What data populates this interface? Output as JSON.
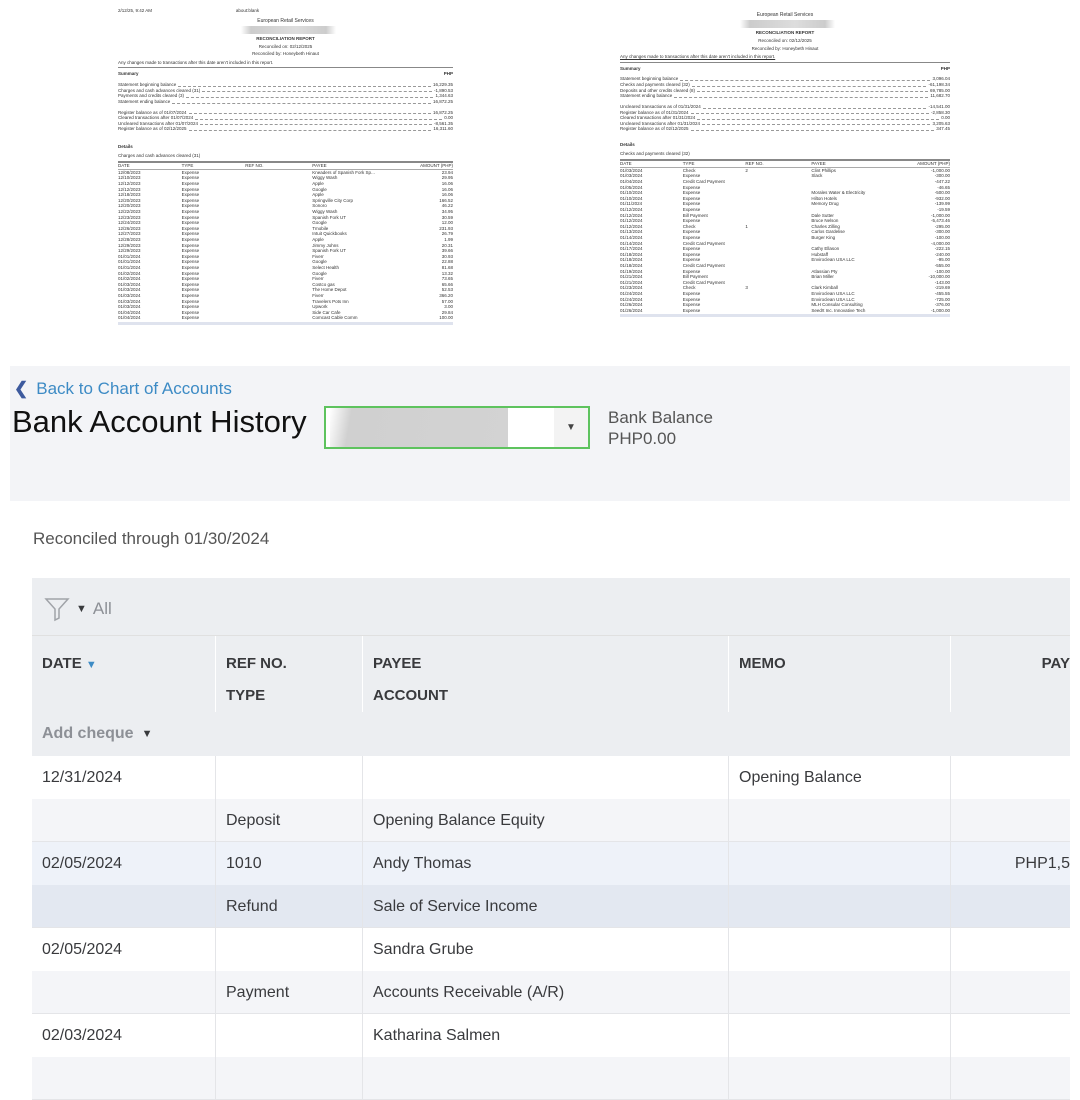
{
  "report_left": {
    "timestamp": "2/12/25, 9:42 AM",
    "page_title": "about:blank",
    "company": "European Retail Services",
    "title": "RECONCILIATION REPORT",
    "reconciled_on": "Reconciled on: 02/12/2025",
    "reconciled_by": "Reconciled by: Honeybeth Hinaut",
    "notice": "Any changes made to transactions after this date aren't included in this report.",
    "summary_label": "Summary",
    "currency": "PHP",
    "summary": [
      {
        "label": "Statement beginning balance",
        "value": "16,229.35"
      },
      {
        "label": "Charges and cash advances cleared (31)",
        "value": "-1,890.53"
      },
      {
        "label": "Payments and credits cleared (3)",
        "value": "1,344.63"
      },
      {
        "label": "Statement ending balance",
        "value": "16,872.25"
      }
    ],
    "summary2": [
      {
        "label": "Register balance as of 01/07/2024",
        "value": "16,872.25"
      },
      {
        "label": "Cleared transactions after 01/07/2024",
        "value": "0.00"
      },
      {
        "label": "Uncleared transactions after 01/07/2024",
        "value": "-8,561.35"
      },
      {
        "label": "Register balance as of 02/12/2025",
        "value": "16,311.60"
      }
    ],
    "details_label": "Details",
    "section_label": "Charges and cash advances cleared (31)",
    "columns": [
      "DATE",
      "TYPE",
      "REF NO.",
      "PAYEE",
      "AMOUNT (PHP)"
    ],
    "rows": [
      [
        "12/08/2023",
        "Expense",
        "",
        "Kneaders of Spanish Fork Sp...",
        "23.94"
      ],
      [
        "12/10/2023",
        "Expense",
        "",
        "Wiggy Wash",
        "29.95"
      ],
      [
        "12/12/2023",
        "Expense",
        "",
        "Apple",
        "16.06"
      ],
      [
        "12/12/2023",
        "Expense",
        "",
        "Google",
        "16.06"
      ],
      [
        "12/18/2023",
        "Expense",
        "",
        "Apple",
        "16.06"
      ],
      [
        "12/20/2023",
        "Expense",
        "",
        "Springville City Corp",
        "166.52"
      ],
      [
        "12/20/2023",
        "Expense",
        "",
        "Sonoro",
        "46.22"
      ],
      [
        "12/22/2023",
        "Expense",
        "",
        "Wiggy Wash",
        "34.95"
      ],
      [
        "12/23/2023",
        "Expense",
        "",
        "Spanish Fork UT",
        "30.59"
      ],
      [
        "12/24/2023",
        "Expense",
        "",
        "Google",
        "12.00"
      ],
      [
        "12/26/2023",
        "Expense",
        "",
        "Tmobile",
        "231.93"
      ],
      [
        "12/27/2023",
        "Expense",
        "",
        "Intuit Quickbooks",
        "26.79"
      ],
      [
        "12/28/2023",
        "Expense",
        "",
        "Apple",
        "1.99"
      ],
      [
        "12/29/2023",
        "Expense",
        "",
        "Jimmy Johns",
        "20.31"
      ],
      [
        "12/29/2023",
        "Expense",
        "",
        "Spanish Fork UT",
        "39.66"
      ],
      [
        "01/01/2024",
        "Expense",
        "",
        "Fiverr",
        "30.93"
      ],
      [
        "01/01/2024",
        "Expense",
        "",
        "Google",
        "22.88"
      ],
      [
        "01/01/2024",
        "Expense",
        "",
        "Select Health",
        "81.68"
      ],
      [
        "01/02/2024",
        "Expense",
        "",
        "Google",
        "13.32"
      ],
      [
        "01/02/2024",
        "Expense",
        "",
        "Fiverr",
        "73.65"
      ],
      [
        "01/03/2024",
        "Expense",
        "",
        "Costco gas",
        "65.66"
      ],
      [
        "01/03/2024",
        "Expense",
        "",
        "The Home Depot",
        "52.53"
      ],
      [
        "01/03/2024",
        "Expense",
        "",
        "Fiverr",
        "366.20"
      ],
      [
        "01/03/2024",
        "Expense",
        "",
        "Travelers Pots Inn",
        "57.00"
      ],
      [
        "01/03/2024",
        "Expense",
        "",
        "Upwork",
        "3.00"
      ],
      [
        "01/04/2024",
        "Expense",
        "",
        "Side Car Cafe",
        "29.84"
      ],
      [
        "01/04/2024",
        "Expense",
        "",
        "Comcast Cable Comm",
        "100.00"
      ]
    ]
  },
  "report_right": {
    "company": "European Retail Services",
    "title": "RECONCILIATION REPORT",
    "reconciled_on": "Reconciled on: 02/12/2025",
    "reconciled_by": "Reconciled by: Honeybeth Hinaut",
    "notice": "Any changes made to transactions after this date aren't included in this report.",
    "summary_label": "Summary",
    "currency": "PHP",
    "summary": [
      {
        "label": "Statement beginning balance",
        "value": "3,096.04"
      },
      {
        "label": "Checks and payments cleared (32)",
        "value": "-61,198.34"
      },
      {
        "label": "Deposits and other credits cleared (8)",
        "value": "69,785.00"
      },
      {
        "label": "Statement ending balance",
        "value": "11,682.70"
      }
    ],
    "summary2": [
      {
        "label": "Uncleared transactions as of 01/31/2024",
        "value": "-14,541.00"
      },
      {
        "label": "Register balance as of 01/31/2024",
        "value": "-2,858.30"
      },
      {
        "label": "Cleared transactions after 01/31/2024",
        "value": "0.00"
      },
      {
        "label": "Uncleared transactions after 01/31/2024",
        "value": "3,205.63"
      },
      {
        "label": "Register balance as of 02/12/2025",
        "value": "347.45"
      }
    ],
    "details_label": "Details",
    "section_label": "Checks and payments cleared (32)",
    "columns": [
      "DATE",
      "TYPE",
      "REF NO.",
      "PAYEE",
      "AMOUNT (PHP)"
    ],
    "rows": [
      [
        "01/03/2024",
        "Check",
        "2",
        "Clint Phillips",
        "-1,000.00"
      ],
      [
        "01/03/2024",
        "Expense",
        "",
        "Slack",
        "-300.00"
      ],
      [
        "01/04/2024",
        "Credit Card Payment",
        "",
        "",
        "-447.22"
      ],
      [
        "01/05/2024",
        "Expense",
        "",
        "",
        "-46.65"
      ],
      [
        "01/10/2024",
        "Expense",
        "",
        "Morales Water & Electricity",
        "-500.00"
      ],
      [
        "01/10/2024",
        "Expense",
        "",
        "Hilton Hotels",
        "-932.00"
      ],
      [
        "01/11/2024",
        "Expense",
        "",
        "Memory Drug",
        "-139.99"
      ],
      [
        "01/12/2024",
        "Expense",
        "",
        "",
        "-19.59"
      ],
      [
        "01/12/2024",
        "Bill Payment",
        "",
        "Dale Sutter",
        "-1,000.00"
      ],
      [
        "01/12/2024",
        "Expense",
        "",
        "Bruce Nelson",
        "-5,473.46"
      ],
      [
        "01/12/2024",
        "Check",
        "1",
        "Charles Zilling",
        "-295.00"
      ],
      [
        "01/13/2024",
        "Expense",
        "",
        "Carlos Gardelise",
        "-300.00"
      ],
      [
        "01/14/2024",
        "Expense",
        "",
        "Burger King",
        "-100.00"
      ],
      [
        "01/14/2024",
        "Credit Card Payment",
        "",
        "",
        "-4,000.00"
      ],
      [
        "01/17/2024",
        "Expense",
        "",
        "Cathy Ellason",
        "-222.15"
      ],
      [
        "01/18/2024",
        "Expense",
        "",
        "Hubstaff",
        "-240.00"
      ],
      [
        "01/18/2024",
        "Expense",
        "",
        "Enviroclean USA LLC",
        "-95.00"
      ],
      [
        "01/18/2024",
        "Credit Card Payment",
        "",
        "",
        "-555.00"
      ],
      [
        "01/19/2024",
        "Expense",
        "",
        "Atlassian Pty",
        "-100.00"
      ],
      [
        "01/21/2024",
        "Bill Payment",
        "",
        "Brian Miller",
        "-10,000.00"
      ],
      [
        "01/21/2024",
        "Credit Card Payment",
        "",
        "",
        "-143.00"
      ],
      [
        "01/23/2024",
        "Check",
        "3",
        "Clark Kimball",
        "-219.69"
      ],
      [
        "01/24/2024",
        "Expense",
        "",
        "Enviroclean USA LLC",
        "-455.55"
      ],
      [
        "01/24/2024",
        "Expense",
        "",
        "Enviroclean USA LLC",
        "-725.00"
      ],
      [
        "01/26/2024",
        "Expense",
        "",
        "MLH Consular Consulting",
        "-376.00"
      ],
      [
        "01/26/2024",
        "Expense",
        "",
        "Seed!t Inc. Innovative Tech",
        "-1,000.00"
      ]
    ]
  },
  "app": {
    "back_link": "Back to Chart of Accounts",
    "page_title": "Bank Account History",
    "bank_balance_label": "Bank Balance",
    "bank_balance_value": "PHP0.00",
    "reconciled_through": "Reconciled through 01/30/2024",
    "filter_label": "All",
    "columns": {
      "date": "DATE",
      "ref": "REF NO.",
      "type": "TYPE",
      "payee": "PAYEE",
      "account": "ACCOUNT",
      "memo": "MEMO",
      "payment": "PAY"
    },
    "add_cheque": "Add cheque",
    "rows": [
      {
        "date": "12/31/2024",
        "ref": "",
        "payee": "",
        "memo": "Opening Balance",
        "payment": "",
        "type": "Deposit",
        "account": "Opening Balance Equity"
      },
      {
        "date": "02/05/2024",
        "ref": "1010",
        "payee": "Andy Thomas",
        "memo": "",
        "payment": "PHP1,5",
        "type": "Refund",
        "account": "Sale of Service Income"
      },
      {
        "date": "02/05/2024",
        "ref": "",
        "payee": "Sandra Grube",
        "memo": "",
        "payment": "",
        "type": "Payment",
        "account": "Accounts Receivable (A/R)"
      },
      {
        "date": "02/03/2024",
        "ref": "",
        "payee": "Katharina Salmen",
        "memo": "",
        "payment": "",
        "type": "",
        "account": ""
      }
    ]
  }
}
